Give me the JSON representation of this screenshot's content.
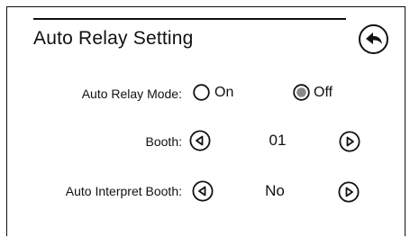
{
  "title": "Auto Relay Setting",
  "icons": {
    "back": "back-arrow-icon",
    "left_arrow": "left-arrow-icon",
    "right_arrow": "right-arrow-icon"
  },
  "auto_relay_mode": {
    "label": "Auto Relay Mode:",
    "options": [
      {
        "label": "On",
        "selected": false
      },
      {
        "label": "Off",
        "selected": true
      }
    ]
  },
  "booth": {
    "label": "Booth:",
    "value": "01"
  },
  "auto_interpret_booth": {
    "label": "Auto Interpret Booth:",
    "value": "No"
  }
}
